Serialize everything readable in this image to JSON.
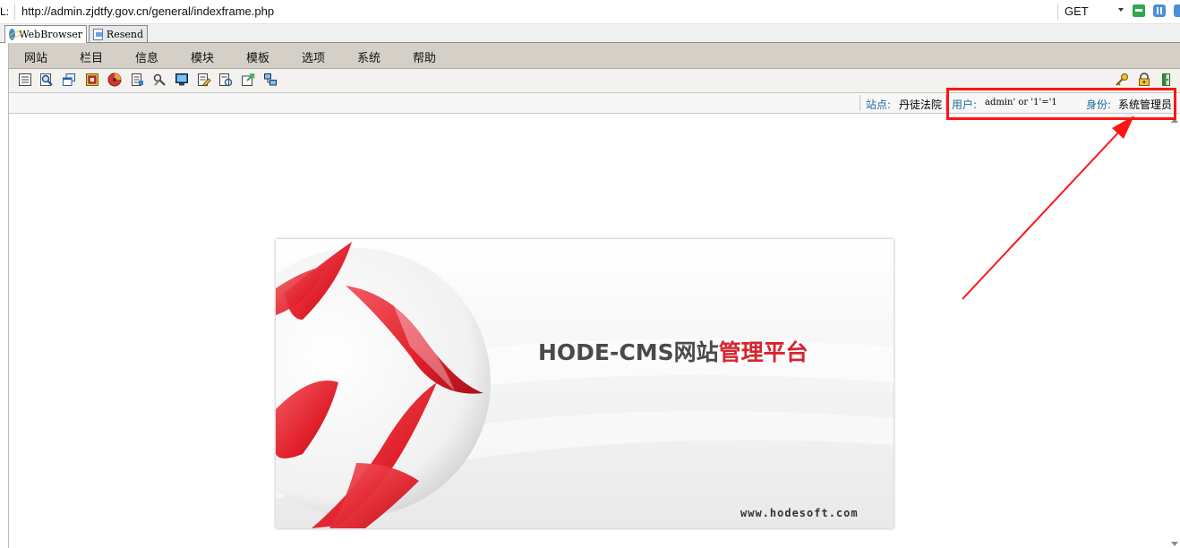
{
  "address_bar": {
    "label": "L:",
    "url": "http://admin.zjdtfy.gov.cn/general/indexframe.php",
    "method": "GET"
  },
  "tabs": [
    {
      "label": "WebBrowser",
      "icon": "browser-globe-icon",
      "active": true
    },
    {
      "label": "Resend",
      "icon": "resend-icon",
      "active": false
    }
  ],
  "menu": {
    "items": [
      "网站",
      "栏目",
      "信息",
      "模块",
      "模板",
      "选项",
      "系统",
      "帮助"
    ]
  },
  "toolbar": {
    "left_icons": [
      "list-icon",
      "search-icon",
      "windows-icon",
      "module-icon",
      "chart-icon",
      "document-icon",
      "tools-icon",
      "monitor-icon",
      "edit-icon",
      "refresh-icon",
      "export-icon",
      "network-icon"
    ],
    "right_icons": [
      "key-icon",
      "lock-icon",
      "exit-icon"
    ]
  },
  "status": {
    "site_label": "站点:",
    "site_value": "丹徒法院",
    "user_label": "用户:",
    "user_value": "admin' or '1'='1",
    "role_label": "身份:",
    "role_value": "系统管理员"
  },
  "splash": {
    "title_part1": "HODE-CMS网站",
    "title_part2": "管理平台",
    "website": "www.hodesoft.com"
  },
  "colors": {
    "annotation_red": "#ff1414",
    "brand_red": "#d6242e",
    "label_blue": "#1c6b9e",
    "menubar_bg": "#d4d0c8"
  }
}
